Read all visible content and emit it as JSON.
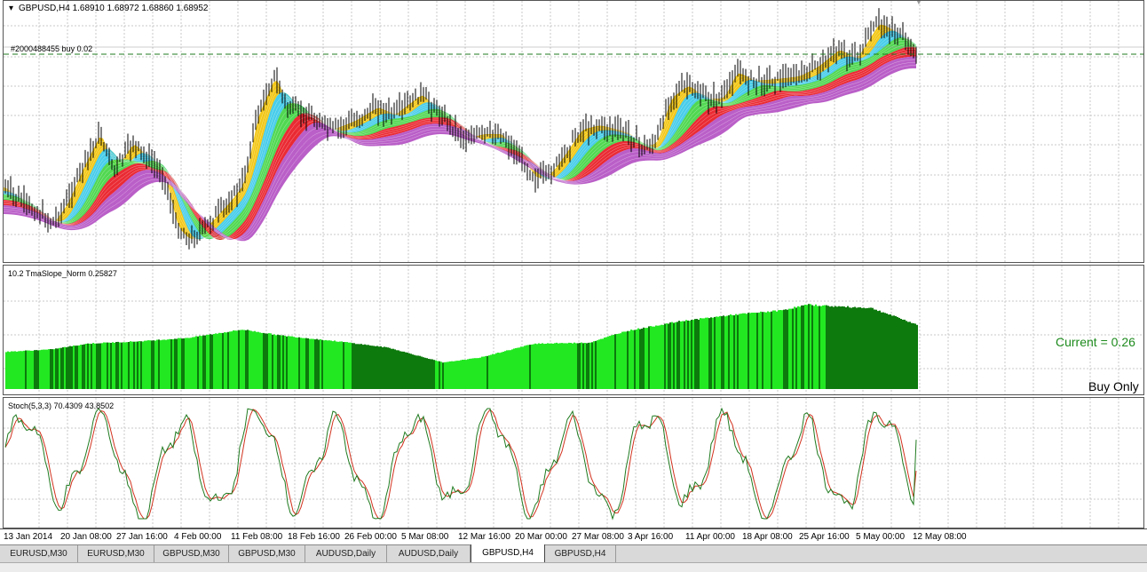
{
  "main_pane": {
    "header": "GBPUSD,H4  1.68910 1.68972 1.68860 1.68952",
    "order_line": "#2000488455 buy 0.02",
    "colors": {
      "candle": "#000000",
      "yellow": "#f2c200",
      "cyan": "#35c8e8",
      "green": "#3fd43f",
      "red": "#e8141e",
      "purple": "#b24ec2",
      "order_line": "#1f7a1f"
    }
  },
  "tma_pane": {
    "header": "10.2 TmaSlope_Norm 0.25827",
    "current_text": "Current = 0.26",
    "signal_text": "Buy Only",
    "colors": {
      "bright": "#22e822",
      "dark": "#0c7a0c",
      "current": "#1d8a1d"
    },
    "profile": [
      [
        0,
        0.45
      ],
      [
        0.05,
        0.48
      ],
      [
        0.09,
        0.55
      ],
      [
        0.15,
        0.58
      ],
      [
        0.2,
        0.62
      ],
      [
        0.26,
        0.72
      ],
      [
        0.3,
        0.65
      ],
      [
        0.37,
        0.57
      ],
      [
        0.42,
        0.5
      ],
      [
        0.47,
        0.35
      ],
      [
        0.48,
        0.32
      ],
      [
        0.52,
        0.38
      ],
      [
        0.58,
        0.55
      ],
      [
        0.64,
        0.56
      ],
      [
        0.68,
        0.7
      ],
      [
        0.74,
        0.82
      ],
      [
        0.8,
        0.9
      ],
      [
        0.85,
        0.95
      ],
      [
        0.88,
        1.02
      ],
      [
        0.91,
        1.0
      ],
      [
        0.95,
        0.98
      ],
      [
        0.99,
        0.82
      ],
      [
        1,
        0.78
      ]
    ]
  },
  "stoch_pane": {
    "header": "Stoch(5,3,3) 70.4309 43.8502",
    "colors": {
      "main": "#1f7a1f",
      "signal": "#d2321e"
    }
  },
  "x_axis": {
    "ticks": [
      "13 Jan 2014",
      "20 Jan 08:00",
      "27 Jan 16:00",
      "4 Feb 00:00",
      "11 Feb 08:00",
      "18 Feb 16:00",
      "26 Feb 00:00",
      "5 Mar 08:00",
      "12 Mar 16:00",
      "20 Mar 00:00",
      "27 Mar 08:00",
      "3 Apr 16:00",
      "11 Apr 00:00",
      "18 Apr 08:00",
      "25 Apr 16:00",
      "5 May 00:00",
      "12 May 08:00"
    ]
  },
  "tabs": [
    {
      "label": "EURUSD,M30",
      "active": false
    },
    {
      "label": "EURUSD,M30",
      "active": false
    },
    {
      "label": "GBPUSD,M30",
      "active": false
    },
    {
      "label": "GBPUSD,M30",
      "active": false
    },
    {
      "label": "AUDUSD,Daily",
      "active": false
    },
    {
      "label": "AUDUSD,Daily",
      "active": false
    },
    {
      "label": "GBPUSD,H4",
      "active": true
    },
    {
      "label": "GBPUSD,H4",
      "active": false
    }
  ]
}
